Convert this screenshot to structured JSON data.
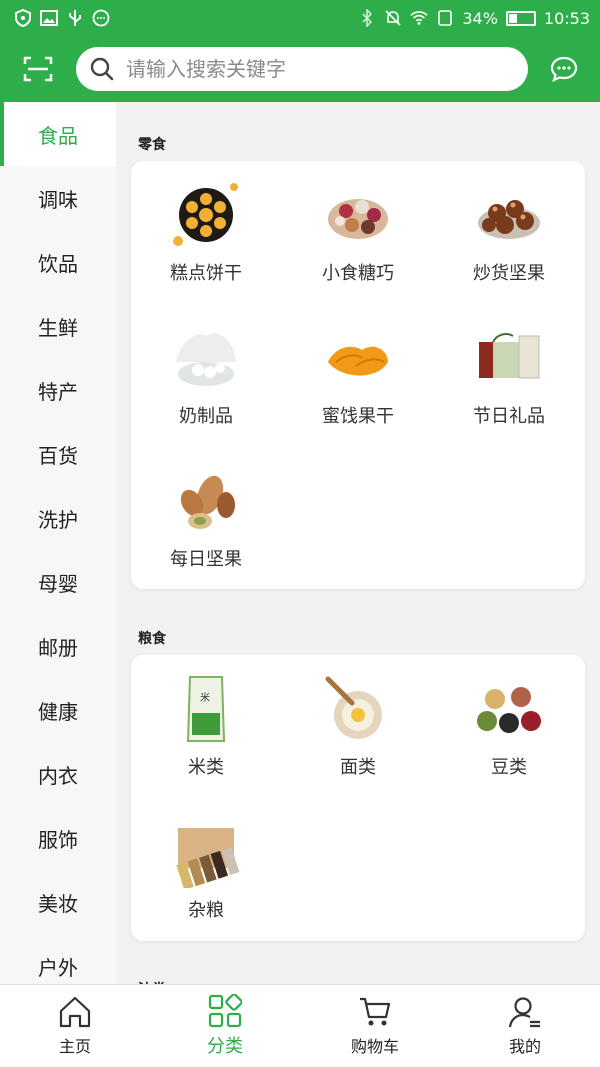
{
  "status_bar": {
    "time": "10:53",
    "battery": "34%",
    "battery_level": 0.34
  },
  "search": {
    "placeholder": "请输入搜索关键字"
  },
  "sidebar": {
    "items": [
      {
        "label": "食品",
        "active": true
      },
      {
        "label": "调味"
      },
      {
        "label": "饮品"
      },
      {
        "label": "生鲜"
      },
      {
        "label": "特产"
      },
      {
        "label": "百货"
      },
      {
        "label": "洗护"
      },
      {
        "label": "母婴"
      },
      {
        "label": "邮册"
      },
      {
        "label": "健康"
      },
      {
        "label": "内衣"
      },
      {
        "label": "服饰"
      },
      {
        "label": "美妆"
      },
      {
        "label": "户外"
      }
    ]
  },
  "sections": [
    {
      "title": "零食",
      "items": [
        {
          "label": "糕点饼干",
          "icon": "cookies-image"
        },
        {
          "label": "小食糖巧",
          "icon": "snack-tray-image"
        },
        {
          "label": "炒货坚果",
          "icon": "chestnuts-image"
        },
        {
          "label": "奶制品",
          "icon": "milk-image"
        },
        {
          "label": "蜜饯果干",
          "icon": "dried-mango-image"
        },
        {
          "label": "节日礼品",
          "icon": "gift-box-image"
        },
        {
          "label": "每日坚果",
          "icon": "mixed-nuts-image"
        }
      ]
    },
    {
      "title": "粮食",
      "items": [
        {
          "label": "米类",
          "icon": "rice-bag-image"
        },
        {
          "label": "面类",
          "icon": "flour-bowl-image"
        },
        {
          "label": "豆类",
          "icon": "beans-image"
        },
        {
          "label": "杂粮",
          "icon": "grains-image"
        }
      ]
    },
    {
      "title": "油类",
      "items": []
    }
  ],
  "bottom_nav": {
    "items": [
      {
        "label": "主页",
        "icon": "home-icon"
      },
      {
        "label": "分类",
        "icon": "category-icon",
        "active": true
      },
      {
        "label": "购物车",
        "icon": "cart-icon"
      },
      {
        "label": "我的",
        "icon": "user-icon"
      }
    ]
  },
  "colors": {
    "brand": "#2eae4a",
    "sidebar_bg": "#f7f7f7",
    "page_bg": "#f2f2f2"
  }
}
